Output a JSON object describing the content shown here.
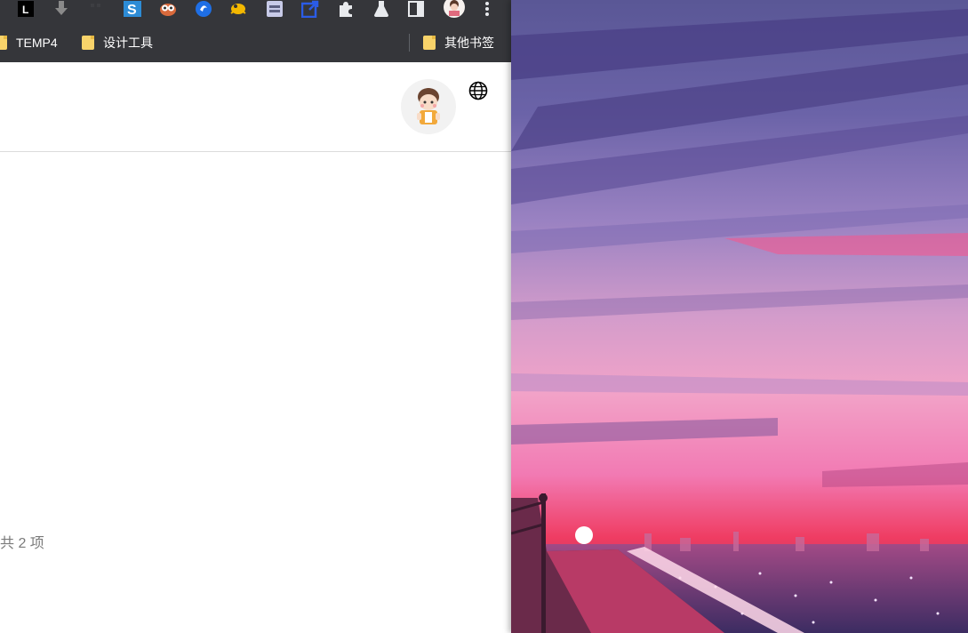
{
  "bookmarks": {
    "items": [
      {
        "label": "TEMP4"
      },
      {
        "label": "设计工具"
      }
    ],
    "other_label": "其他书签"
  },
  "extensions": [
    {
      "icon": "letter-l-icon"
    },
    {
      "icon": "download-arrow-icon"
    },
    {
      "icon": "grid-icon"
    },
    {
      "icon": "s-logo-icon"
    },
    {
      "icon": "owl-icon"
    },
    {
      "icon": "blue-circle-icon"
    },
    {
      "icon": "yellow-creature-icon"
    },
    {
      "icon": "window-icon"
    },
    {
      "icon": "blue-box-icon"
    },
    {
      "icon": "puzzle-icon"
    },
    {
      "icon": "flask-icon"
    },
    {
      "icon": "sidebar-icon"
    },
    {
      "icon": "profile-avatar-icon"
    },
    {
      "icon": "more-menu-icon"
    }
  ],
  "page": {
    "total_text": "共 2 项"
  },
  "colors": {
    "chrome_dark": "#35363a",
    "folder_yellow": "#f8d36a",
    "divider": "#dcdcdc",
    "muted_text": "#7a7a7a",
    "sky_top": "#4f4b8e",
    "sky_pink": "#f27ab3",
    "horizon_red": "#ef3c62"
  }
}
